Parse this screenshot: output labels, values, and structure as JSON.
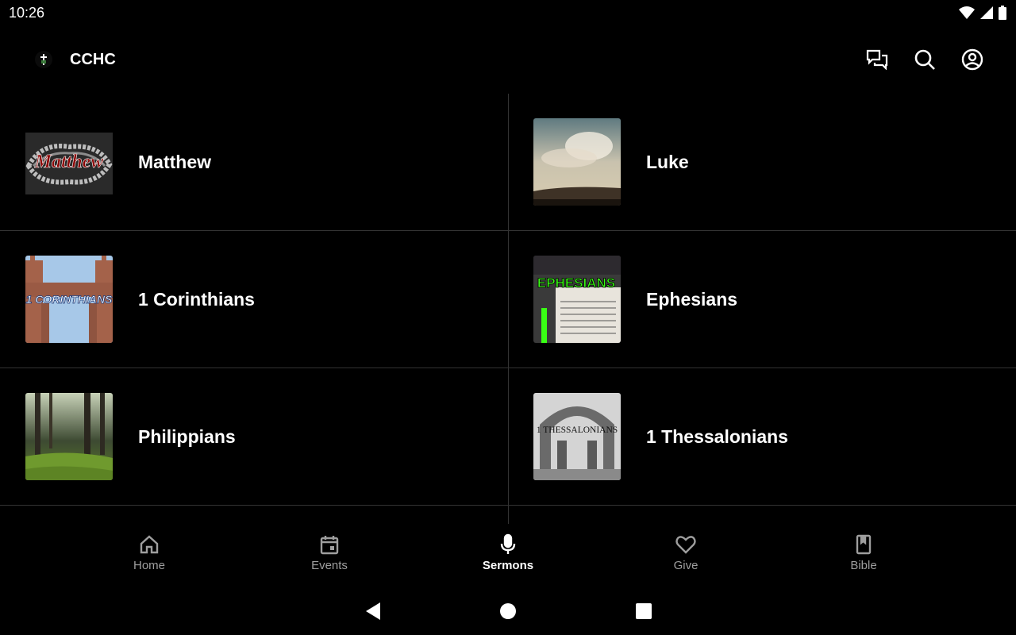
{
  "status": {
    "time": "10:26"
  },
  "app": {
    "title": "CCHC"
  },
  "sermon_series": [
    {
      "title": "Matthew",
      "thumb_icon": "matthew-thumbnail"
    },
    {
      "title": "Luke",
      "thumb_icon": "luke-thumbnail"
    },
    {
      "title": "1 Corinthians",
      "thumb_icon": "1-corinthians-thumbnail"
    },
    {
      "title": "Ephesians",
      "thumb_icon": "ephesians-thumbnail"
    },
    {
      "title": "Philippians",
      "thumb_icon": "philippians-thumbnail"
    },
    {
      "title": "1 Thessalonians",
      "thumb_icon": "1-thessalonians-thumbnail"
    }
  ],
  "thumb_text": {
    "matthew": "Matthew",
    "corinthians": "1 CORINTHIANS",
    "ephesians": "EPHESIANS",
    "thessalonians": "1 THESSALONIANS"
  },
  "nav": {
    "items": [
      {
        "label": "Home",
        "icon": "home-icon"
      },
      {
        "label": "Events",
        "icon": "calendar-icon"
      },
      {
        "label": "Sermons",
        "icon": "microphone-icon"
      },
      {
        "label": "Give",
        "icon": "heart-icon"
      },
      {
        "label": "Bible",
        "icon": "book-icon"
      }
    ],
    "active": "Sermons"
  },
  "colors": {
    "background": "#000000",
    "divider": "#333333",
    "inactive": "#9e9e9e",
    "active": "#ffffff"
  }
}
